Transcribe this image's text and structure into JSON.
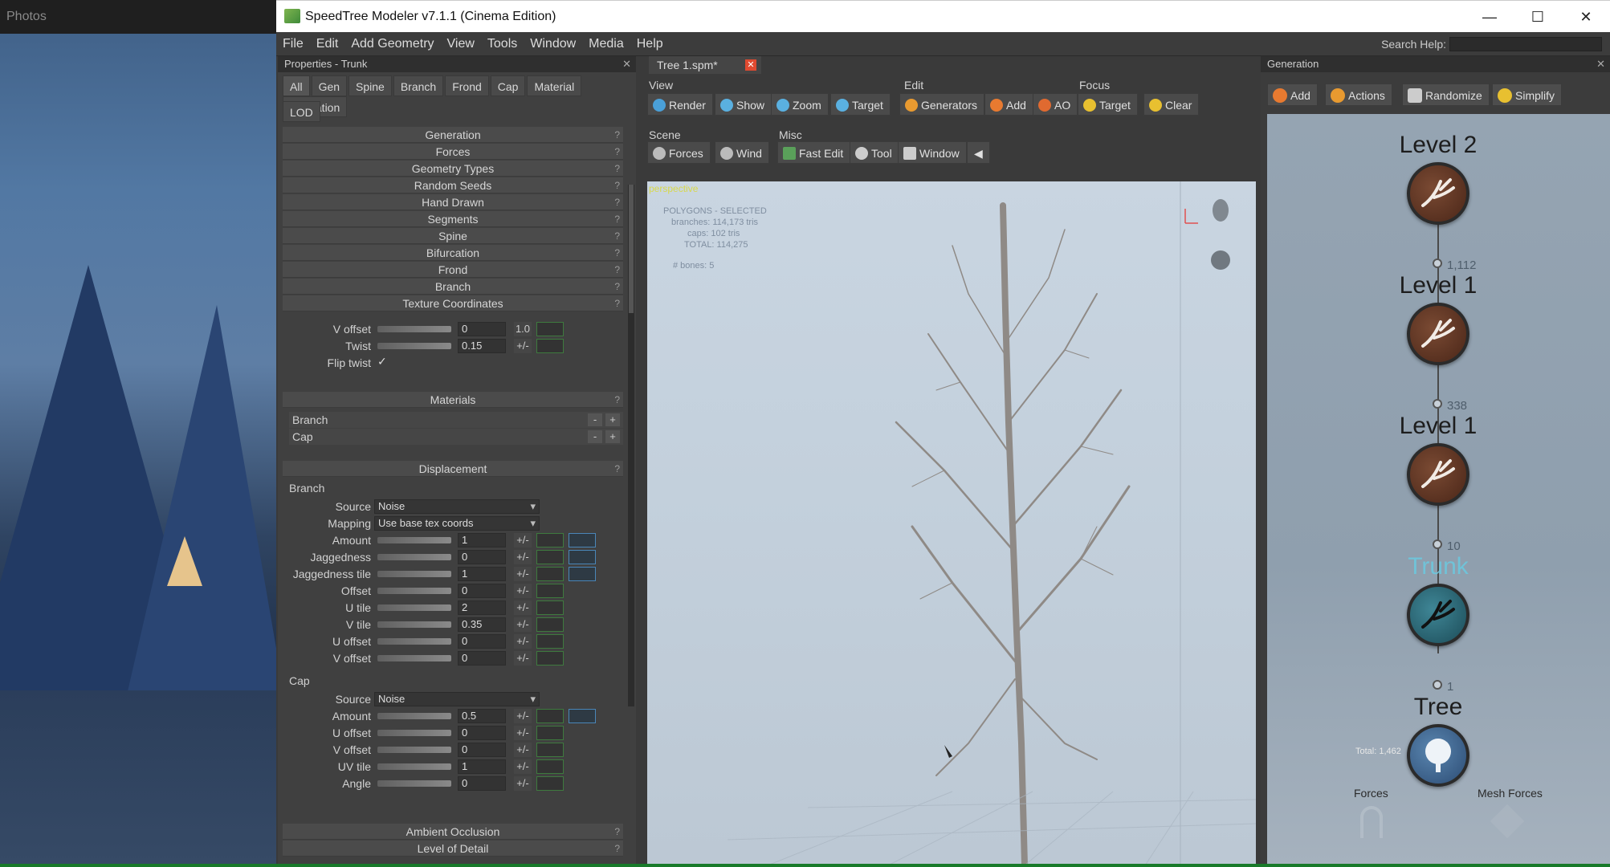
{
  "photos": {
    "title": "Photos"
  },
  "window": {
    "title": "SpeedTree Modeler v7.1.1 (Cinema Edition)",
    "controls": [
      "—",
      "☐",
      "✕"
    ]
  },
  "menu": {
    "items": [
      "File",
      "Edit",
      "Add Geometry",
      "View",
      "Tools",
      "Window",
      "Media",
      "Help"
    ],
    "search_label": "Search Help:"
  },
  "properties": {
    "header": "Properties - Trunk",
    "tabs": [
      "All",
      "Gen",
      "Spine",
      "Branch",
      "Frond",
      "Cap",
      "Material",
      "Animation"
    ],
    "lod_tab": "LOD",
    "sections": [
      "Generation",
      "Forces",
      "Geometry Types",
      "Random Seeds",
      "Hand Drawn",
      "Segments",
      "Spine",
      "Bifurcation",
      "Frond",
      "Branch",
      "Texture Coordinates"
    ],
    "tex_rows": [
      {
        "label": "V offset",
        "value": "0",
        "extra": "1.0"
      },
      {
        "label": "Twist",
        "value": "0.15"
      }
    ],
    "flip_twist": "Flip twist",
    "materials_header": "Materials",
    "materials": [
      "Branch",
      "Cap"
    ],
    "displacement_header": "Displacement",
    "branch_group": "Branch",
    "branch_source_label": "Source",
    "branch_source": "Noise",
    "branch_mapping_label": "Mapping",
    "branch_mapping": "Use base tex coords",
    "branch_rows": [
      {
        "label": "Amount",
        "value": "1"
      },
      {
        "label": "Jaggedness",
        "value": "0"
      },
      {
        "label": "Jaggedness tile",
        "value": "1"
      },
      {
        "label": "Offset",
        "value": "0"
      },
      {
        "label": "U tile",
        "value": "2"
      },
      {
        "label": "V tile",
        "value": "0.35"
      },
      {
        "label": "U offset",
        "value": "0"
      },
      {
        "label": "V offset",
        "value": "0"
      }
    ],
    "cap_group": "Cap",
    "cap_source_label": "Source",
    "cap_source": "Noise",
    "cap_rows": [
      {
        "label": "Amount",
        "value": "0.5"
      },
      {
        "label": "U offset",
        "value": "0"
      },
      {
        "label": "V offset",
        "value": "0"
      },
      {
        "label": "UV tile",
        "value": "1"
      },
      {
        "label": "Angle",
        "value": "0"
      }
    ],
    "bottom_sections": [
      "Ambient Occlusion",
      "Level of Detail"
    ],
    "plusminus": "+/-"
  },
  "tree_window": {
    "tab": "Tree 1.spm*",
    "groups": {
      "view": "View",
      "edit": "Edit",
      "focus": "Focus",
      "scene": "Scene",
      "misc": "Misc"
    },
    "view_buttons": [
      "Render",
      "Show",
      "Zoom",
      "Target"
    ],
    "edit_buttons": [
      "Generators",
      "Add",
      "AO"
    ],
    "focus_buttons": [
      "Target",
      "Clear"
    ],
    "scene_buttons": [
      "Forces",
      "Wind"
    ],
    "misc_buttons": [
      "Fast Edit",
      "Tool",
      "Window"
    ],
    "viewport": {
      "label": "perspective",
      "stats": [
        "POLYGONS - SELECTED",
        "branches: 114,173 tris",
        "caps: 102 tris",
        "TOTAL: 114,275",
        "# bones: 5"
      ]
    }
  },
  "generation": {
    "header": "Generation",
    "buttons": [
      "Add",
      "Actions",
      "Randomize",
      "Simplify"
    ],
    "nodes": [
      "Level 2",
      "Level 1",
      "Level 1",
      "Trunk",
      "Tree"
    ],
    "counts": [
      "1,112",
      "338",
      "10",
      "1"
    ],
    "total": "Total: 1,462",
    "bottom": [
      "Forces",
      "Mesh Forces"
    ]
  },
  "colors": {
    "accent_trunk": "#70c3d8",
    "close_tab": "#e04a30",
    "viewport_bg": "#c9d5e1"
  }
}
